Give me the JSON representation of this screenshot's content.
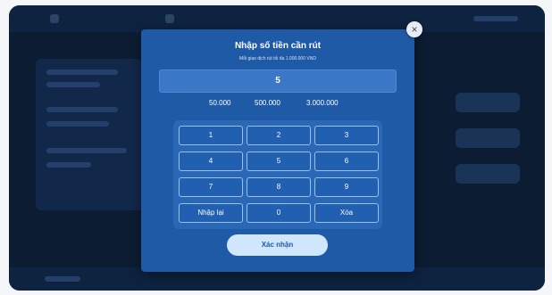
{
  "modal": {
    "title": "Nhập số tiền cần rút",
    "subtitle": "Mỗi giao dịch rút tối đa 1.000.000 VND",
    "amount_value": "5",
    "quick_amounts": [
      "50.000",
      "500.000",
      "3.000.000"
    ],
    "keypad": [
      "1",
      "2",
      "3",
      "4",
      "5",
      "6",
      "7",
      "8",
      "9",
      "Nhập lại",
      "0",
      "Xóa"
    ],
    "confirm_label": "Xác nhận",
    "close_icon": "×"
  },
  "colors": {
    "modal_bg": "#1e5aa6",
    "confirm_bg": "#cfe6fb",
    "backdrop": "#0c1d33"
  }
}
